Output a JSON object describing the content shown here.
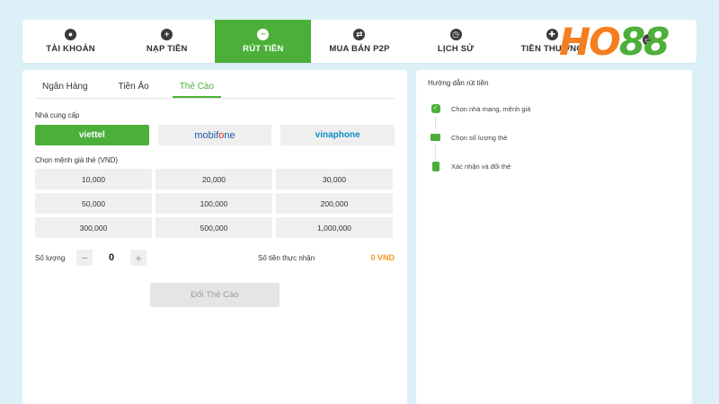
{
  "nav": {
    "tabs": [
      {
        "label": "TÀI KHOẢN",
        "icon": "user-icon"
      },
      {
        "label": "NẠP TIỀN",
        "icon": "plus-icon"
      },
      {
        "label": "RÚT TIỀN",
        "icon": "minus-icon",
        "active": true
      },
      {
        "label": "MUA BÁN P2P",
        "icon": "exchange-icon"
      },
      {
        "label": "LỊCH SỬ",
        "icon": "clock-icon"
      },
      {
        "label": "TIỀN THƯỞNG",
        "icon": "gift-icon"
      },
      {
        "label": "",
        "icon": "card-icon"
      }
    ]
  },
  "logo": {
    "text_h": "HO",
    "text_88": "88"
  },
  "withdraw": {
    "subtabs": [
      "Ngân Hàng",
      "Tiền Ảo",
      "Thẻ Cào"
    ],
    "provider_label": "Nhà cung cấp",
    "providers": {
      "viettel": "viettel",
      "mobifone_a": "mobif",
      "mobifone_b": "o",
      "mobifone_c": "ne",
      "vinaphone": "vinaphone"
    },
    "denom_label": "Chọn mệnh giá thẻ (VND)",
    "denominations": [
      "10,000",
      "20,000",
      "30,000",
      "50,000",
      "100,000",
      "200,000",
      "300,000",
      "500,000",
      "1,000,000"
    ],
    "quantity_label": "Số lượng",
    "quantity_value": "0",
    "minus": "−",
    "plus": "+",
    "received_label": "Số tiền thực nhận",
    "received_value": "0 VND",
    "submit_label": "Đổi Thẻ Cào"
  },
  "guide": {
    "title": "Hướng dẫn rút tiền",
    "steps": [
      "Chọn nhà mạng, mệnh giá",
      "Chọn số lượng thẻ",
      "Xác nhận và đổi thẻ"
    ]
  },
  "colors": {
    "accent": "#4caf39",
    "warning": "#f39a1d",
    "background": "#dcf1f7"
  }
}
